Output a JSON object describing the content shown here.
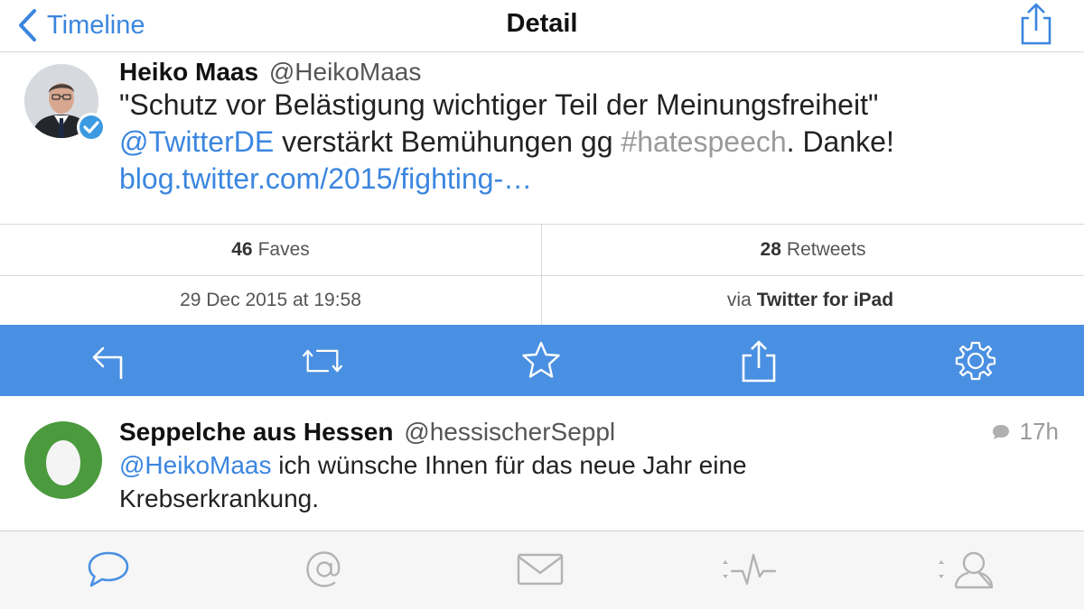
{
  "nav": {
    "back_label": "Timeline",
    "title": "Detail",
    "share_icon": "share-icon"
  },
  "tweet": {
    "name": "Heiko Maas",
    "handle": "@HeikoMaas",
    "verified": true,
    "line1": "\"Schutz vor Belästigung wichtiger Teil der Meinungsfreiheit\"",
    "mention": "@TwitterDE",
    "mid_text": " verstärkt Bemühungen gg ",
    "hashtag": "#hatespeech",
    "end_text": ". Danke!",
    "link": "blog.twitter.com/2015/fighting-…"
  },
  "stats": {
    "faves_count": "46",
    "faves_label": "Faves",
    "retweets_count": "28",
    "retweets_label": "Retweets",
    "datetime": "29 Dec 2015 at 19:58",
    "via_prefix": "via",
    "source": "Twitter for iPad"
  },
  "actions": [
    "reply-icon",
    "retweet-icon",
    "star-icon",
    "share-icon",
    "gear-icon"
  ],
  "reply": {
    "name": "Seppelche aus Hessen",
    "handle": "@hessischerSeppl",
    "time": "17h",
    "mention": "@HeikoMaas",
    "text": " ich wünsche Ihnen für das neue Jahr eine Krebserkrankung."
  },
  "tabs": [
    "timeline-bubble-icon",
    "mentions-at-icon",
    "messages-envelope-icon",
    "activity-pulse-icon",
    "profile-person-icon"
  ],
  "colors": {
    "accent": "#3b86e0",
    "action_bar": "#4a90e2",
    "hashtag": "#9a9a9a",
    "egg_avatar": "#4b9a3e",
    "tab_icons": "#b3b3b3"
  }
}
